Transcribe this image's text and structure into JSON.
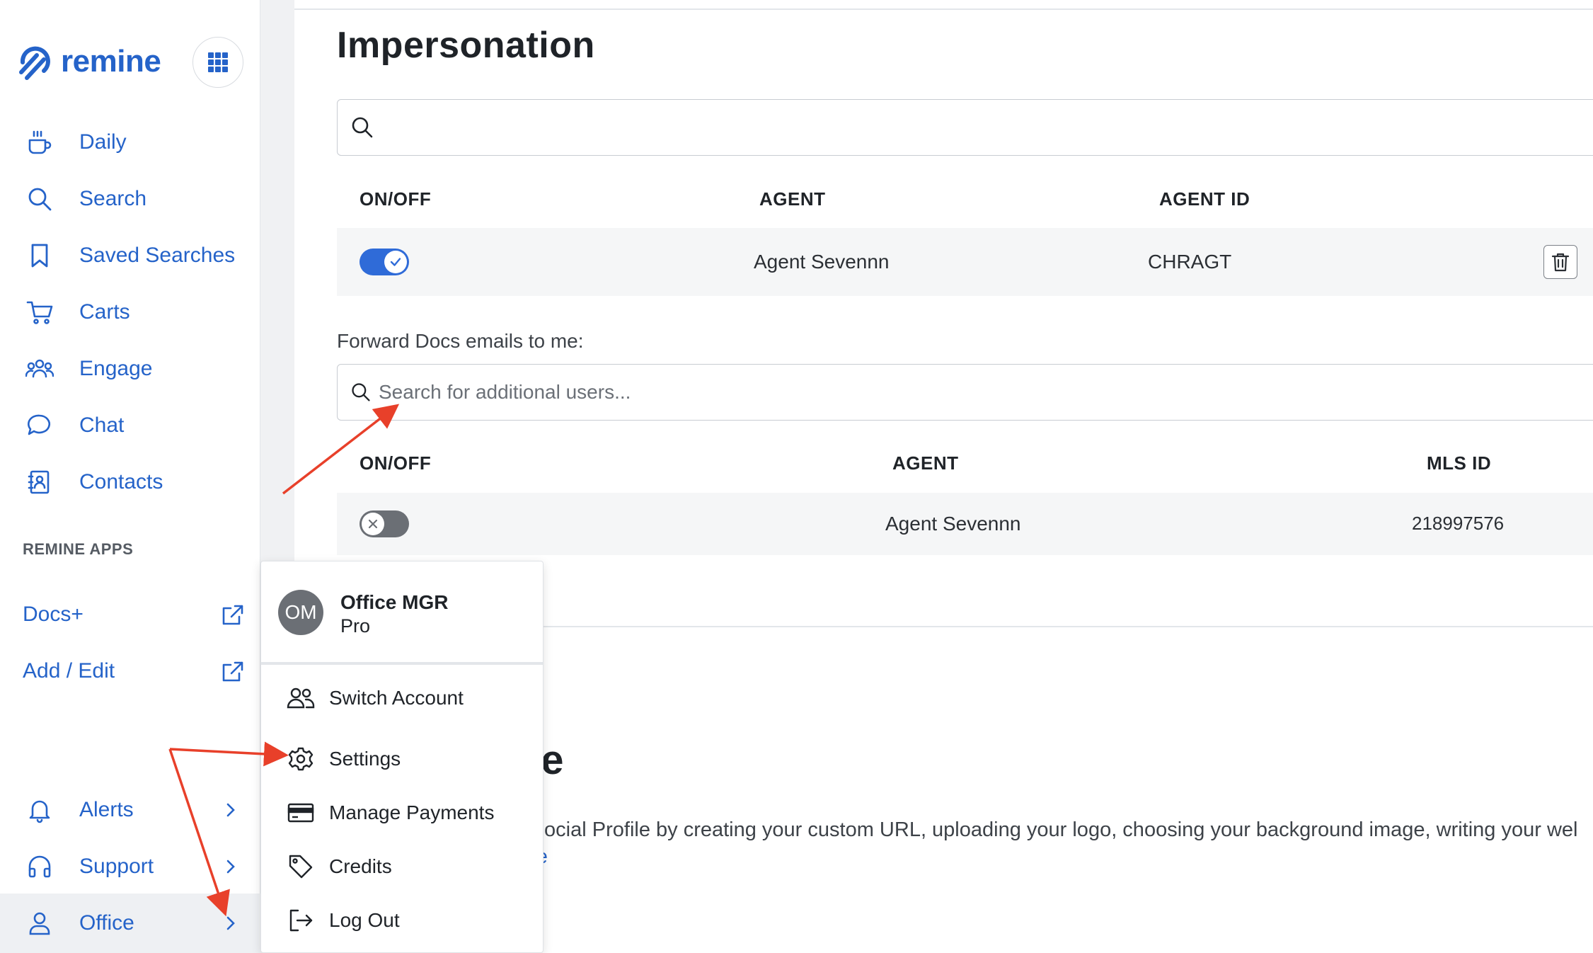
{
  "sidebar": {
    "brand": "remine",
    "nav": [
      {
        "label": "Daily",
        "icon": "coffee-icon"
      },
      {
        "label": "Search",
        "icon": "search-icon"
      },
      {
        "label": "Saved Searches",
        "icon": "bookmark-icon"
      },
      {
        "label": "Carts",
        "icon": "cart-icon"
      },
      {
        "label": "Engage",
        "icon": "users-icon"
      },
      {
        "label": "Chat",
        "icon": "chat-bubble-icon"
      },
      {
        "label": "Contacts",
        "icon": "contact-card-icon"
      }
    ],
    "apps_section_label": "REMINE APPS",
    "apps": [
      {
        "label": "Docs+"
      },
      {
        "label": "Add / Edit"
      }
    ],
    "bottom": [
      {
        "label": "Alerts",
        "icon": "bell-icon"
      },
      {
        "label": "Support",
        "icon": "headset-icon"
      },
      {
        "label": "Office",
        "icon": "user-icon"
      }
    ]
  },
  "main": {
    "title": "Impersonation",
    "search": {
      "placeholder": ""
    },
    "impersonation_table": {
      "headers": [
        "ON/OFF",
        "AGENT",
        "AGENT ID"
      ],
      "rows": [
        {
          "enabled": true,
          "agent": "Agent Sevennn",
          "agent_id": "CHRAGT"
        }
      ]
    },
    "forward_label": "Forward Docs emails to me:",
    "forward_search": {
      "placeholder": "Search for additional users..."
    },
    "forward_table": {
      "headers": [
        "ON/OFF",
        "AGENT",
        "MLS ID"
      ],
      "rows": [
        {
          "enabled": false,
          "agent": "Agent Sevennn",
          "mls_id": "218997576"
        }
      ]
    },
    "profile_title_partial": "ile",
    "profile_text_partial": "r Social Profile by creating your custom URL, uploading your logo, choosing your background image, writing your wel",
    "profile_link_partial": "ore"
  },
  "menu": {
    "avatar_initials": "OM",
    "name": "Office MGR",
    "role": "Pro",
    "items": [
      {
        "label": "Switch Account",
        "icon": "switch-account-icon"
      },
      {
        "label": "Settings",
        "icon": "gear-icon"
      },
      {
        "label": "Manage Payments",
        "icon": "credit-card-icon"
      },
      {
        "label": "Credits",
        "icon": "tag-icon"
      },
      {
        "label": "Log Out",
        "icon": "logout-icon"
      }
    ]
  },
  "colors": {
    "brand": "#2563c9",
    "toggle_on": "#2f6bd8",
    "toggle_off": "#6b6f75",
    "annotation_arrow": "#e8402a"
  }
}
